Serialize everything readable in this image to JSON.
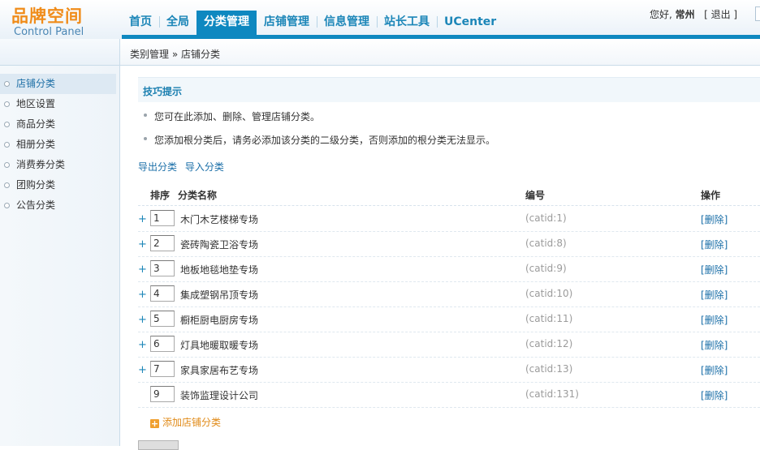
{
  "header": {
    "brand": "品牌空间",
    "subtitle": "Control Panel",
    "nav": [
      "首页",
      "全局",
      "分类管理",
      "店铺管理",
      "信息管理",
      "站长工具",
      "UCenter"
    ],
    "active_nav": "分类管理",
    "greeting": "您好,",
    "username": "常州",
    "logout": "[ 退出 ]"
  },
  "sidebar": {
    "items": [
      "店铺分类",
      "地区设置",
      "商品分类",
      "相册分类",
      "消费券分类",
      "团购分类",
      "公告分类"
    ],
    "active": "店铺分类"
  },
  "breadcrumb": {
    "parent": "类别管理",
    "separator": "»",
    "current": "店铺分类"
  },
  "tips": {
    "title": "技巧提示",
    "items": [
      "您可在此添加、删除、管理店铺分类。",
      "您添加根分类后，请务必添加该分类的二级分类，否则添加的根分类无法显示。"
    ]
  },
  "actions": {
    "export": "导出分类",
    "import": "导入分类"
  },
  "table": {
    "headers": {
      "order": "排序",
      "name": "分类名称",
      "id": "编号",
      "action": "操作"
    },
    "rows": [
      {
        "has_children": "+",
        "order": "1",
        "name": "木门木艺楼梯专场",
        "catid": "(catid:1)",
        "action": "[删除]"
      },
      {
        "has_children": "+",
        "order": "2",
        "name": "瓷砖陶瓷卫浴专场",
        "catid": "(catid:8)",
        "action": "[删除]"
      },
      {
        "has_children": "+",
        "order": "3",
        "name": "地板地毯地垫专场",
        "catid": "(catid:9)",
        "action": "[删除]"
      },
      {
        "has_children": "+",
        "order": "4",
        "name": "集成塑钢吊顶专场",
        "catid": "(catid:10)",
        "action": "[删除]"
      },
      {
        "has_children": "+",
        "order": "5",
        "name": "橱柜厨电厨房专场",
        "catid": "(catid:11)",
        "action": "[删除]"
      },
      {
        "has_children": "+",
        "order": "6",
        "name": "灯具地暖取暖专场",
        "catid": "(catid:12)",
        "action": "[删除]"
      },
      {
        "has_children": "+",
        "order": "7",
        "name": "家具家居布艺专场",
        "catid": "(catid:13)",
        "action": "[删除]"
      },
      {
        "has_children": "",
        "order": "9",
        "name": "装饰监理设计公司",
        "catid": "(catid:131)",
        "action": "[删除]"
      }
    ],
    "add_label": "添加店铺分类"
  },
  "colors": {
    "accent": "#0e88c0",
    "brand": "#f08c1a",
    "link": "#1b6fa8"
  }
}
